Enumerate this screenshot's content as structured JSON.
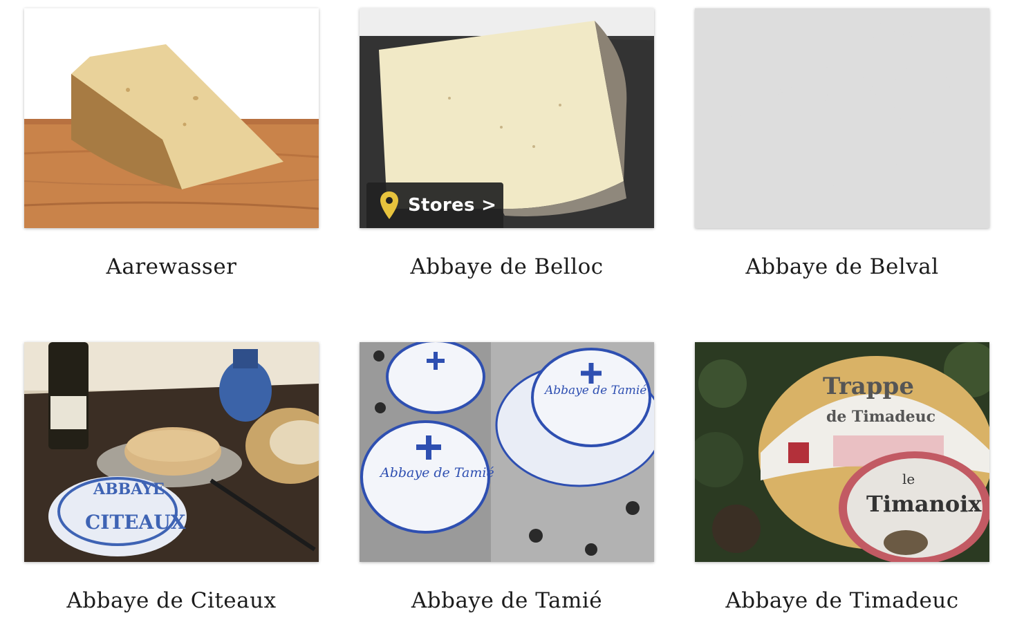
{
  "accent_color": "#e7c33d",
  "cheeses": [
    {
      "name": "Aarewasser",
      "image": "cheese-wedge-on-wood-photo"
    },
    {
      "name": "Abbaye de Belloc",
      "image": "cheese-wedge-on-slate-photo",
      "stores_label": "Stores >",
      "stores_icon": "map-pin-icon"
    },
    {
      "name": "Abbaye de Belval",
      "image": "cheese-placeholder-icon"
    },
    {
      "name": "Abbaye de Citeaux",
      "image": "citeaux-table-photo",
      "wrapper_text": [
        "ABBAYE",
        "CITEAUX"
      ]
    },
    {
      "name": "Abbaye de Tamié",
      "image": "tamie-wheels-photo",
      "wrapper_text": [
        "Abbaye de Tamié"
      ]
    },
    {
      "name": "Abbaye de Timadeuc",
      "image": "timadeuc-wheel-photo",
      "wrapper_text": [
        "Trappe",
        "de Timadeuc",
        "le",
        "Timanoix"
      ]
    }
  ]
}
